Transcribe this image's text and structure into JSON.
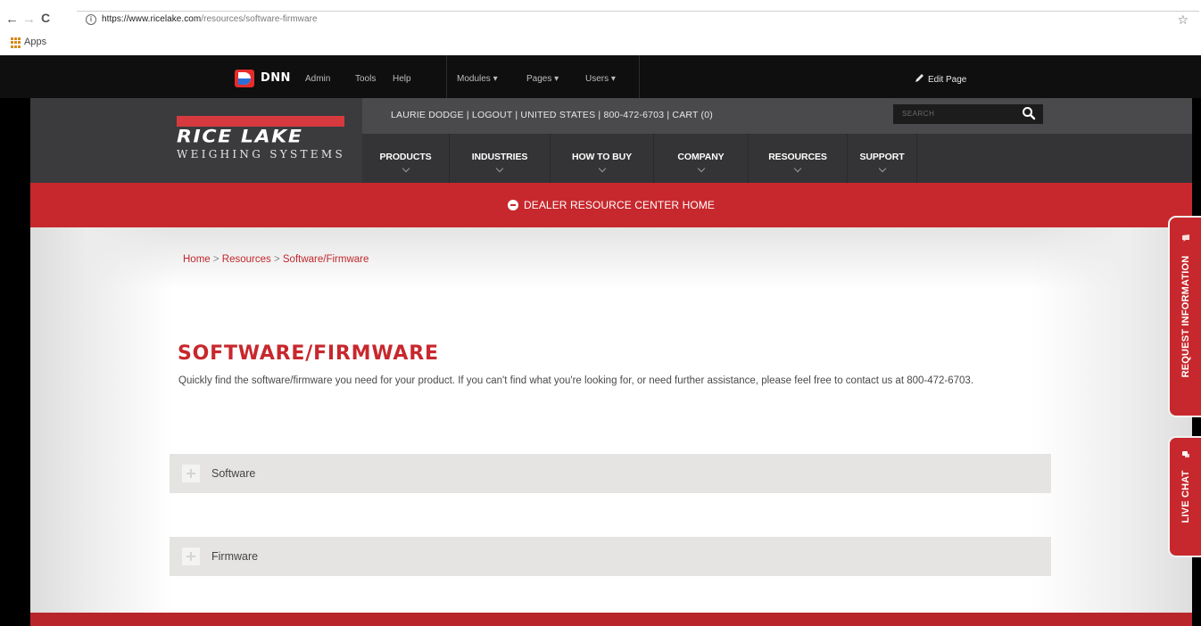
{
  "browser": {
    "url_host": "https://www.ricelake.com",
    "url_path": "/resources/software-firmware",
    "back": "←",
    "forward": "→",
    "reload": "C",
    "star": "☆",
    "apps_label": "Apps"
  },
  "dnn_bar": {
    "logo": "DNN",
    "links": [
      "Admin",
      "Tools",
      "Help"
    ],
    "menus": [
      "Modules ▾",
      "Pages ▾",
      "Users ▾"
    ],
    "edit_page": "Edit Page",
    "colors": {
      "dnn_red": "#e62b2b",
      "dnn_blue": "#2b6fd6"
    }
  },
  "header": {
    "logo_main": "RICE LAKE",
    "logo_sub": "WEIGHING SYSTEMS",
    "utility_text": "LAURIE DODGE  |  LOGOUT  |  UNITED STATES  |  800-472-6703  |  CART (0)",
    "search_placeholder": "SEARCH",
    "nav": [
      "PRODUCTS",
      "INDUSTRIES",
      "HOW TO BUY",
      "COMPANY",
      "RESOURCES",
      "SUPPORT"
    ]
  },
  "dealer": {
    "label": "DEALER RESOURCE CENTER HOME"
  },
  "content": {
    "breadcrumb": {
      "home": "Home",
      "sep": " > ",
      "resources": "Resources",
      "current": "Software/Firmware"
    },
    "title": "SOFTWARE/FIRMWARE",
    "intro": "Quickly find the software/firmware you need for your product. If you can't find what you're looking for, or need further assistance, please feel free to contact us at 800-472-6703.",
    "accordions": [
      "Software",
      "Firmware"
    ]
  },
  "side_tabs": {
    "request": "REQUEST INFORMATION",
    "chat": "LIVE CHAT"
  },
  "colors": {
    "brand_red": "#c7282d",
    "header_dark": "#3b3b3d",
    "nav_dark": "#343436"
  }
}
